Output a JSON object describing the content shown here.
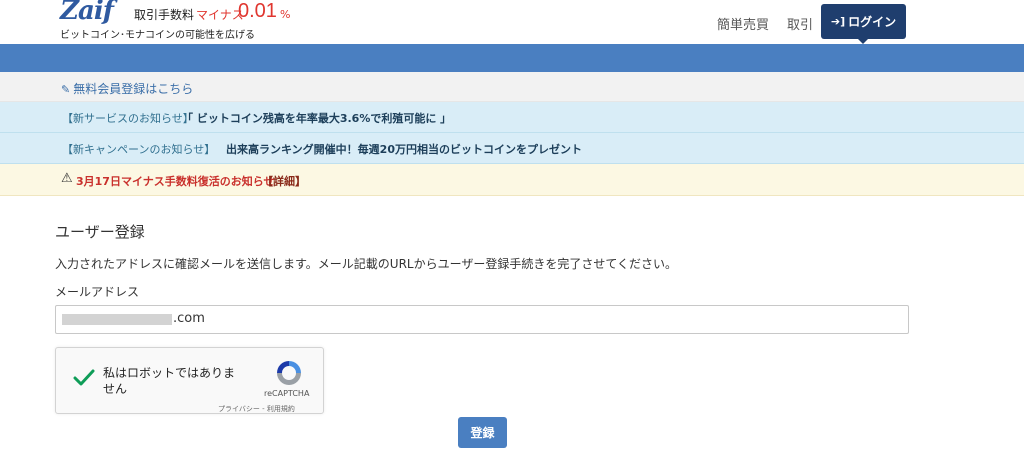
{
  "header": {
    "logo": "Zaif",
    "fee_label": "取引手数料",
    "fee_minus": "マイナス",
    "fee_rate": "0.01",
    "fee_pct": "%",
    "tagline": "ビットコイン･モナコインの可能性を広げる",
    "nav": {
      "simple_trade": "簡単売買",
      "trade": "取引",
      "login": "ログイン"
    }
  },
  "register_link": "無料会員登録はこちら",
  "notices": [
    {
      "tag": "【新サービスのお知らせ】",
      "text": "「 ビットコイン残高を年率最大3.6%で利殖可能に 」"
    },
    {
      "tag": "【新キャンペーンのお知らせ】",
      "text": "出来高ランキング開催中！毎週20万円相当のビットコインをプレゼント"
    }
  ],
  "warning": {
    "text": "3月17日マイナス手数料復活のお知らせ",
    "detail": "【詳細】"
  },
  "form": {
    "title": "ユーザー登録",
    "description": "入力されたアドレスに確認メールを送信します。メール記載のURLからユーザー登録手続きを完了させてください。",
    "email_label": "メールアドレス",
    "email_value_visible": ".com",
    "captcha": {
      "label": "私はロボットではありません",
      "brand": "reCAPTCHA",
      "terms": "プライバシー - 利用規約"
    },
    "submit": "登録"
  },
  "colors": {
    "brand_blue": "#4a7fc1",
    "nav_dark": "#1f3e6e",
    "accent_red": "#e0362f",
    "info_bg": "#d9edf7",
    "warn_bg": "#fcf8e3"
  },
  "icons": [
    "pencil-icon",
    "login-icon",
    "warning-icon",
    "check-icon",
    "recaptcha-icon"
  ]
}
